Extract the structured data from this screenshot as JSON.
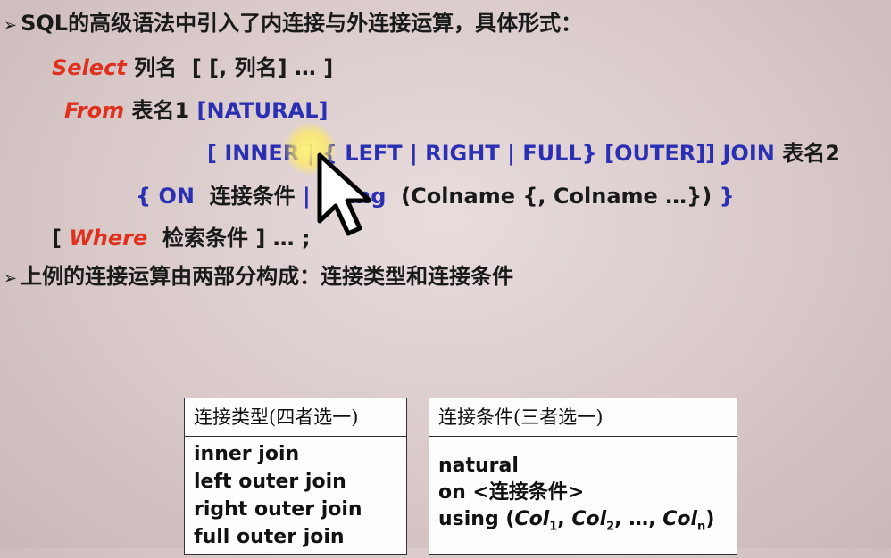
{
  "line1": {
    "bullet": "➢",
    "text": "SQL的高级语法中引入了内连接与外连接运算，具体形式："
  },
  "line2": {
    "select": "Select",
    "col": "列名",
    "rest": "[ [, 列名] … ]"
  },
  "line3": {
    "from": "From",
    "table1": "表名1",
    "natural": "[NATURAL]"
  },
  "line4": {
    "part1": "[ INNER | { LEFT | RIGHT | FULL} [OUTER]] JOIN",
    "table2": "表名2"
  },
  "line5": {
    "on": "{ ON",
    "cond": "连接条件",
    "using": "| Using",
    "colnames": "(Colname {, Colname …})",
    "close": "}"
  },
  "line6": {
    "open": "[",
    "where": "Where",
    "cond": "检索条件 ] … ;"
  },
  "line7": {
    "bullet": "➢",
    "text": "上例的连接运算由两部分构成：连接类型和连接条件"
  },
  "table_types": {
    "header": "连接类型(四者选一)",
    "items": [
      "inner join",
      "left outer join",
      "right outer join",
      "full outer join"
    ]
  },
  "table_conditions": {
    "header": "连接条件(三者选一)",
    "natural": "natural",
    "on": "on <连接条件>",
    "using_prefix": "using (",
    "col": "Col",
    "sub1": "1",
    "sub2": "2",
    "subn": "n",
    "sep": ", ",
    "ellipsis": "…, ",
    "close": ")"
  },
  "colors": {
    "red_keyword": "#e0301e",
    "blue_keyword": "#2b2fb3",
    "text": "#1a1a1a"
  }
}
